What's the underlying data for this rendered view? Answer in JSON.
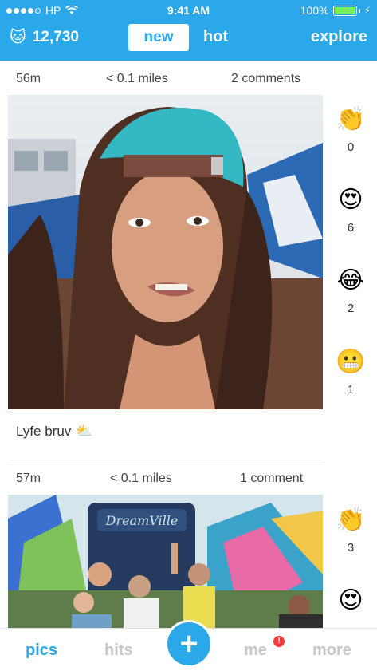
{
  "status_bar": {
    "carrier": "HP",
    "time": "9:41 AM",
    "battery": "100%",
    "battery_level": 1.0
  },
  "header": {
    "score": "12,730",
    "tabs": [
      {
        "label": "new",
        "active": true
      },
      {
        "label": "hot",
        "active": false
      }
    ],
    "explore_label": "explore"
  },
  "posts": [
    {
      "age": "56m",
      "distance": "< 0.1 miles",
      "comments": "2 comments",
      "photo_icon": "selfie-photo",
      "caption": "Lyfe bruv",
      "caption_emoji": "⛅",
      "reactions": [
        {
          "emoji": "👏",
          "icon": "clap-icon",
          "count": "0"
        },
        {
          "emoji": "😍",
          "icon": "heart-eyes-icon",
          "count": "6"
        },
        {
          "emoji": "😂",
          "icon": "tears-of-joy-icon",
          "count": "2"
        },
        {
          "emoji": "😬",
          "icon": "grimace-icon",
          "count": "1"
        }
      ]
    },
    {
      "age": "57m",
      "distance": "< 0.1 miles",
      "comments": "1 comment",
      "photo_icon": "festival-photo",
      "photo_sign": "DreamVille",
      "reactions": [
        {
          "emoji": "👏",
          "icon": "clap-icon",
          "count": "3"
        },
        {
          "emoji": "😍",
          "icon": "heart-eyes-icon",
          "count": ""
        }
      ]
    }
  ],
  "bottom_nav": {
    "pics": "pics",
    "hits": "hits",
    "plus": "+",
    "me": "me",
    "me_badge": "!",
    "more": "more"
  },
  "colors": {
    "accent": "#2aa8ea",
    "inactive": "#c8c8c8",
    "badge": "#ff3a3a"
  }
}
